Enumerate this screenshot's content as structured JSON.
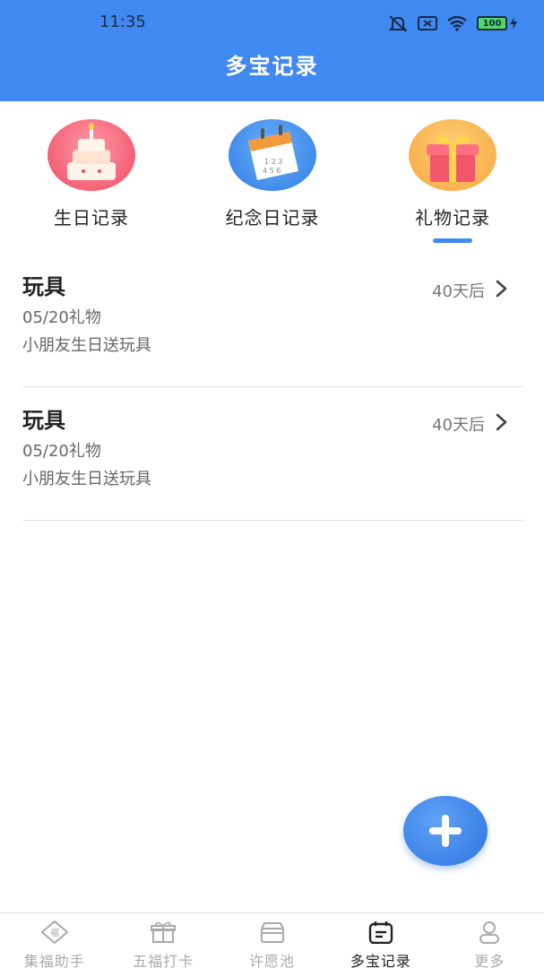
{
  "status_bar": {
    "time": "11:35",
    "battery": "100"
  },
  "header": {
    "title": "多宝记录"
  },
  "categories": [
    {
      "label": "生日记录",
      "icon": "birthday-cake-icon"
    },
    {
      "label": "纪念日记录",
      "icon": "calendar-icon"
    },
    {
      "label": "礼物记录",
      "icon": "gift-box-icon",
      "selected": true
    }
  ],
  "records": [
    {
      "title": "玩具",
      "date_label": "05/20礼物",
      "note": "小朋友生日送玩具",
      "countdown": "40天后"
    },
    {
      "title": "玩具",
      "date_label": "05/20礼物",
      "note": "小朋友生日送玩具",
      "countdown": "40天后"
    }
  ],
  "fab": {
    "icon": "plus-icon"
  },
  "tabbar": [
    {
      "label": "集福助手",
      "icon": "fu-diamond-icon"
    },
    {
      "label": "五福打卡",
      "icon": "gift-icon"
    },
    {
      "label": "许愿池",
      "icon": "wish-box-icon"
    },
    {
      "label": "多宝记录",
      "icon": "record-icon",
      "active": true
    },
    {
      "label": "更多",
      "icon": "user-icon"
    }
  ],
  "colors": {
    "accent": "#4089f2",
    "text": "#222222",
    "muted": "#666666",
    "tab_inactive": "#aaaaaa"
  }
}
